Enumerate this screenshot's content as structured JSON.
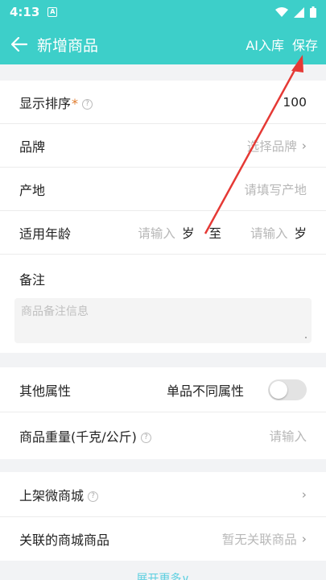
{
  "status_bar": {
    "time": "4:13",
    "notification_glyph": "A"
  },
  "app_bar": {
    "title": "新增商品",
    "ai_label": "AI入库",
    "save_label": "保存"
  },
  "form": {
    "sort": {
      "label": "显示排序",
      "required_mark": "*",
      "help": "?",
      "value": "100"
    },
    "brand": {
      "label": "品牌",
      "placeholder": "选择品牌"
    },
    "origin": {
      "label": "产地",
      "placeholder": "请填写产地"
    },
    "age": {
      "label": "适用年龄",
      "from_placeholder": "请输入",
      "from_unit": "岁",
      "to": "至",
      "to_placeholder": "请输入",
      "to_unit": "岁"
    },
    "notes": {
      "label": "备注",
      "placeholder": "商品备注信息"
    }
  },
  "attributes": {
    "other": {
      "label": "其他属性",
      "toggle_label": "单品不同属性",
      "toggle_on": false
    },
    "weight": {
      "label": "商品重量(千克/公斤)",
      "help": "?",
      "placeholder": "请输入"
    }
  },
  "mall": {
    "listing": {
      "label": "上架微商城",
      "help": "?"
    },
    "linked": {
      "label": "关联的商城商品",
      "value": "暂无关联商品"
    }
  },
  "expand_label": "展开更多∨",
  "colors": {
    "accent": "#3dcfc9",
    "annotation_arrow": "#e53935",
    "link": "#5ccfe0"
  }
}
